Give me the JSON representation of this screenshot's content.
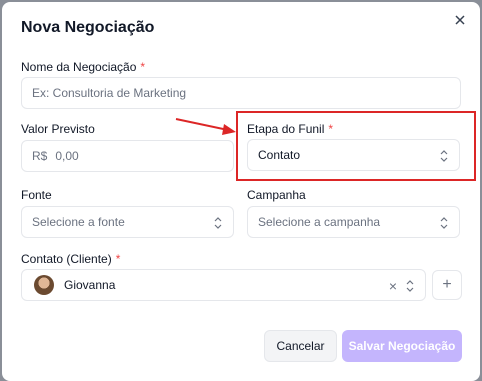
{
  "modal": {
    "title": "Nova Negociação",
    "nome": {
      "label": "Nome da Negociação",
      "required_mark": "*",
      "placeholder": "Ex: Consultoria de Marketing"
    },
    "valor": {
      "label": "Valor Previsto",
      "prefix": "R$",
      "placeholder": "0,00"
    },
    "etapa": {
      "label": "Etapa do Funil",
      "required_mark": "*",
      "value": "Contato"
    },
    "fonte": {
      "label": "Fonte",
      "placeholder": "Selecione a fonte"
    },
    "campanha": {
      "label": "Campanha",
      "placeholder": "Selecione a campanha"
    },
    "contato": {
      "label": "Contato (Cliente)",
      "required_mark": "*",
      "value": "Giovanna",
      "clear_glyph": "×"
    },
    "add_button": {
      "glyph": "+"
    },
    "cancel_label": "Cancelar",
    "save_label": "Salvar Negociação"
  },
  "colors": {
    "accent_disabled": "#c4b5fd",
    "required": "#ef4444",
    "highlight": "#dc2626",
    "overlay": "#8a8f98"
  },
  "icons": [
    "close-icon",
    "chevron-up-down-icon",
    "plus-icon",
    "annotation-arrow"
  ]
}
